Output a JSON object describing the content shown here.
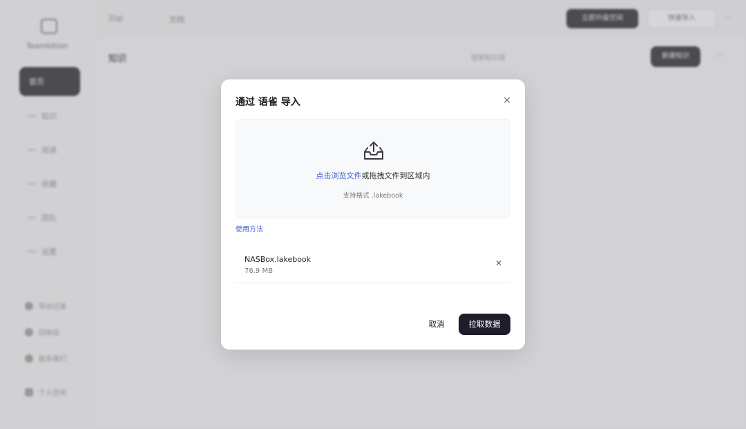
{
  "background": {
    "brand_name": "Teambition",
    "nav": [
      "首页",
      "知识",
      "阅读",
      "收藏",
      "团队",
      "设置"
    ],
    "bottom": [
      "导出记录",
      "回收站",
      "联系我们"
    ],
    "user": "个人空间",
    "topbar": {
      "crumb": "Ziqi",
      "crumb2": "文档",
      "dark_btn": "立即升级空间",
      "light_btn": "快速导入"
    },
    "content": {
      "title": "知识",
      "search": "搜索知识库",
      "new_btn": "新建知识"
    }
  },
  "modal": {
    "title": "通过 语雀 导入",
    "close_icon": "close-icon",
    "dropzone": {
      "icon": "upload-tray-icon",
      "link_text": "点击浏览文件",
      "rest_text": "或拖拽文件到区域内",
      "hint": "支持格式 .lakebook"
    },
    "help_link": "使用方法",
    "file": {
      "name": "NASBox.lakebook",
      "size": "76.9 MB",
      "remove_icon": "close-icon"
    },
    "cancel_label": "取消",
    "confirm_label": "拉取数据"
  }
}
